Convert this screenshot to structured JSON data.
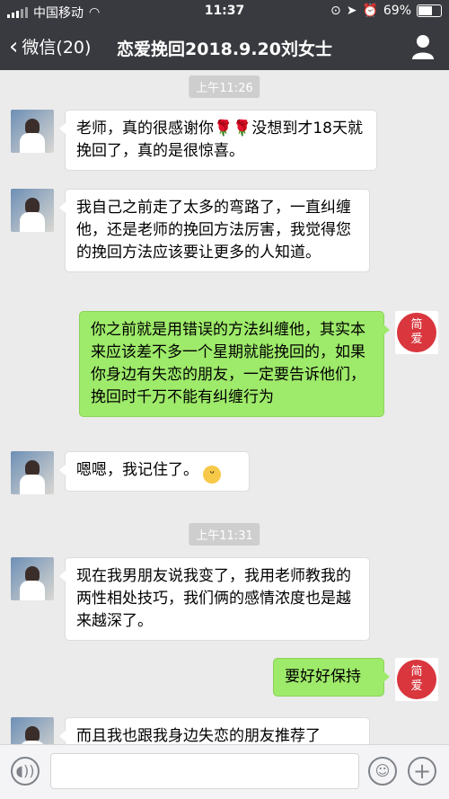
{
  "status": {
    "carrier": "中国移动",
    "time": "11:37",
    "battery": "69%",
    "battery_level": 0.69
  },
  "nav": {
    "back_label": "微信(20)",
    "title": "恋爱挽回2018.9.20刘女士"
  },
  "times": [
    "上午11:26",
    "上午11:31"
  ],
  "avatar_right_text": [
    "简",
    "爱"
  ],
  "messages": [
    {
      "side": "left",
      "text": "老师，真的很感谢你",
      "emoji_text": "🌹🌹",
      "after": "没想到才18天就挽回了，真的是很惊喜。"
    },
    {
      "side": "left",
      "text": "我自己之前走了太多的弯路了，一直纠缠他，还是老师的挽回方法厉害，我觉得您的挽回方法应该要让更多的人知道。"
    },
    {
      "side": "right",
      "text": "你之前就是用错误的方法纠缠他，其实本来应该差不多一个星期就能挽回的，如果你身边有失恋的朋友，一定要告诉他们，挽回时千万不能有纠缠行为"
    },
    {
      "side": "left",
      "text": "嗯嗯，我记住了。"
    },
    {
      "side": "left",
      "text": "现在我男朋友说我变了，我用老师教我的两性相处技巧，我们俩的感情浓度也是越来越深了。"
    },
    {
      "side": "right",
      "text": "要好好保持"
    },
    {
      "side": "left",
      "text": "而且我也跟我身边失恋的朋友推荐了"
    }
  ]
}
